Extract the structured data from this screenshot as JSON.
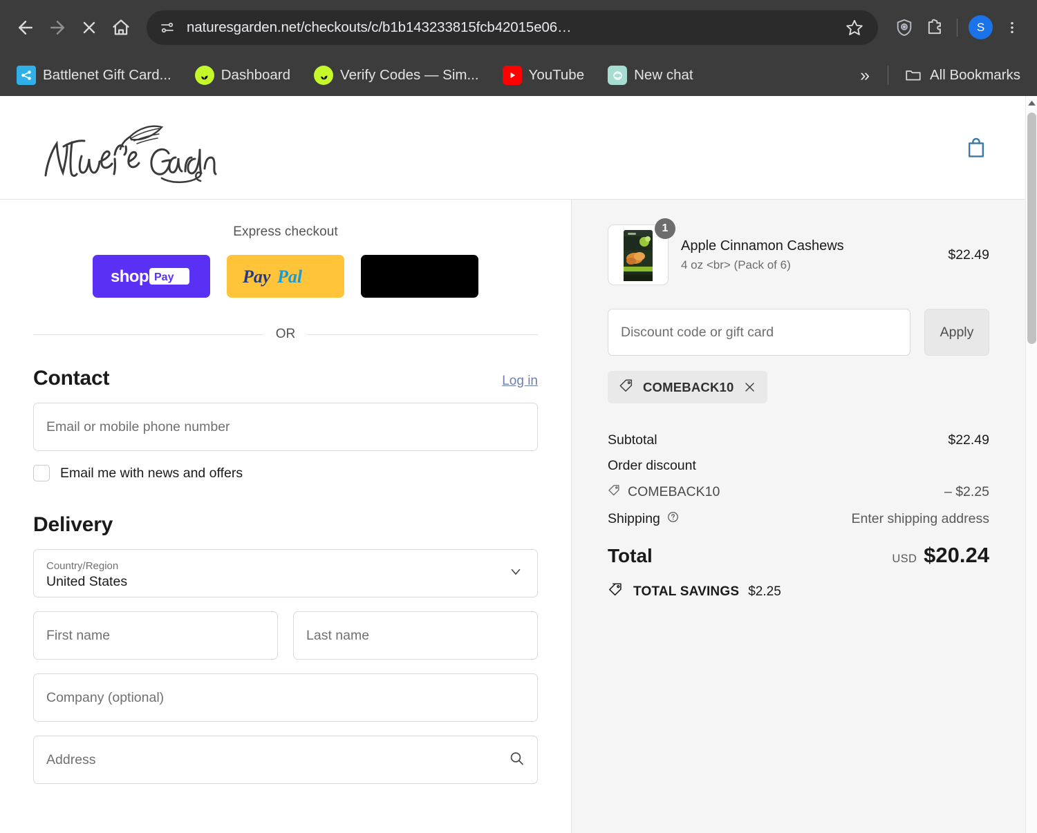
{
  "browser": {
    "nav": {
      "back_icon": "arrow-left-icon",
      "forward_icon": "arrow-right-icon",
      "stop_icon": "close-x-icon",
      "home_icon": "home-icon"
    },
    "omnibox": {
      "site_settings_icon": "page-settings-icon",
      "url": "naturesgarden.net/checkouts/c/b1b143233815fcb42015e06…",
      "bookmark_star_icon": "star-outline-icon"
    },
    "toolbar_icons": [
      {
        "name": "shield-extension-icon"
      },
      {
        "name": "extensions-puzzle-icon"
      }
    ],
    "profile_initial": "S",
    "menu_icon": "three-dot-menu-icon",
    "bookmarks": [
      {
        "label": "Battlenet Gift Card...",
        "icon": "battlenet-favicon",
        "color": "#2fb1e8"
      },
      {
        "label": "Dashboard",
        "icon": "green-circle-favicon",
        "color": "#c4f82a"
      },
      {
        "label": "Verify Codes — Sim...",
        "icon": "green-circle-favicon",
        "color": "#c4f82a"
      },
      {
        "label": "YouTube",
        "icon": "youtube-favicon",
        "color": "#ff0000"
      },
      {
        "label": "New chat",
        "icon": "chatgpt-favicon",
        "color": "#a5ded0"
      }
    ],
    "overflow_label": "»",
    "all_bookmarks_label": "All Bookmarks",
    "all_bookmarks_icon": "folder-icon"
  },
  "site": {
    "logo_text": "Nature's Garden",
    "cart_icon": "shopping-bag-icon",
    "accent_color": "#3a78a8"
  },
  "checkout": {
    "express": {
      "title": "Express checkout",
      "buttons": [
        {
          "name": "shop-pay-button",
          "label": "shop Pay",
          "bg": "#5a31f4"
        },
        {
          "name": "paypal-button",
          "label": "PayPal",
          "bg": "#ffc43a"
        },
        {
          "name": "other-express-button",
          "label": "",
          "bg": "#000000"
        }
      ],
      "divider_text": "OR"
    },
    "contact": {
      "title": "Contact",
      "login_label": "Log in",
      "email_placeholder": "Email or mobile phone number",
      "email_value": "",
      "newsletter_label": "Email me with news and offers",
      "newsletter_checked": false
    },
    "delivery": {
      "title": "Delivery",
      "country_label": "Country/Region",
      "country_value": "United States",
      "first_name_placeholder": "First name",
      "first_name_value": "",
      "last_name_placeholder": "Last name",
      "last_name_value": "",
      "company_placeholder": "Company (optional)",
      "company_value": "",
      "address_placeholder": "Address",
      "address_value": "",
      "address_search_icon": "search-icon"
    }
  },
  "summary": {
    "line_items": [
      {
        "title": "Apple Cinnamon Cashews",
        "variant": "4 oz  <br> (Pack of 6)",
        "price": "$22.49",
        "quantity": "1",
        "thumb_alt": "apple-cinnamon-cashews-pouch"
      }
    ],
    "discount": {
      "placeholder": "Discount code or gift card",
      "value": "",
      "apply_label": "Apply",
      "applied_codes": [
        {
          "code": "COMEBACK10",
          "remove_icon": "close-x-icon",
          "tag_icon": "tag-icon"
        }
      ]
    },
    "totals": {
      "subtotal_label": "Subtotal",
      "subtotal_value": "$22.49",
      "order_discount_label": "Order discount",
      "discount_code_label": "COMEBACK10",
      "discount_code_value": "– $2.25",
      "shipping_label": "Shipping",
      "shipping_info_icon": "question-circle-icon",
      "shipping_value": "Enter shipping address",
      "total_label": "Total",
      "currency": "USD",
      "total_value": "$20.24",
      "savings_label": "TOTAL SAVINGS",
      "savings_value": "$2.25",
      "savings_icon": "double-tag-icon"
    }
  },
  "scrollbar": {
    "up_arrow_icon": "chevron-up-icon",
    "thumb_color": "#c1c1c1"
  }
}
